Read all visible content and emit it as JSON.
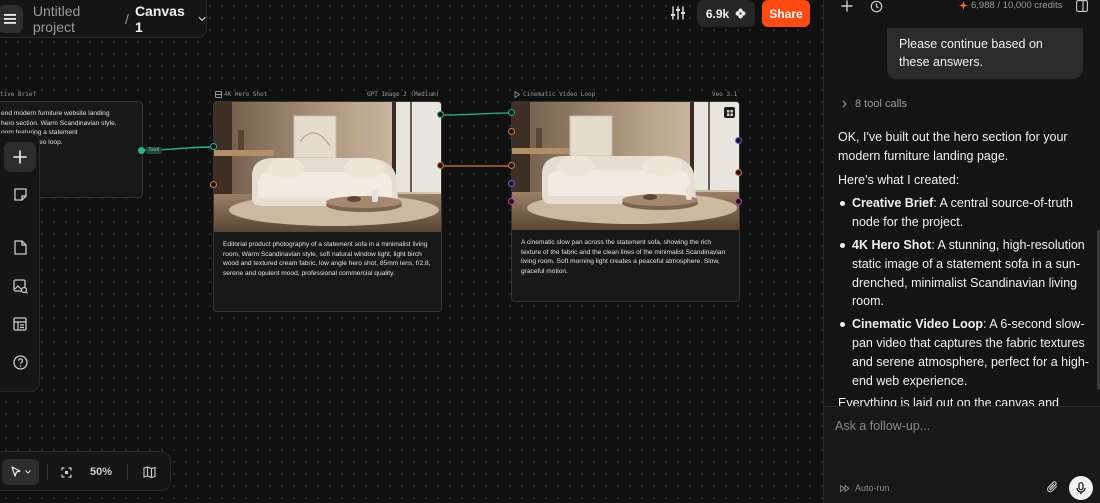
{
  "header": {
    "project_name": "Untitled project",
    "separator": "/",
    "canvas_name": "Canvas 1",
    "credits_short": "6.9k",
    "share_label": "Share"
  },
  "canvas": {
    "zoom": "50%",
    "edge_label": "Text",
    "nodes": [
      {
        "title": "tive Brief",
        "model": "",
        "text": "end modern furniture website landing\nhero section. Warm Scandinavian style,\noom featuring a statement\ncinematic video loop."
      },
      {
        "title": "4K Hero Shot",
        "model": "GPT Image 2 (Medium)",
        "text": "Editorial product photography of a statement sofa in a minimalist living room, Warm Scandinavian style, soft natural window light, light birch wood and textured cream fabric, low angle hero shot, 85mm lens, f/2.8, serene and opulent mood, professional commercial quality."
      },
      {
        "title": "Cinematic Video Loop",
        "model": "Veo 3.1",
        "text": "A cinematic slow pan across the statement sofa, showing the rich texture of the fabric and the clean lines of the minimalist Scandinavian living room. Soft morning light creates a peaceful atmosphere. Slow, graceful motion."
      }
    ]
  },
  "panel": {
    "credits": "6,988 / 10,000 credits",
    "user_message": "Please continue based on these answers.",
    "tool_calls": "8 tool calls",
    "intro": "OK, I've built out the hero section for your modern furniture landing page.",
    "created_heading": "Here's what I created:",
    "bullets": [
      {
        "name": "Creative Brief",
        "desc": ": A central source-of-truth node for the project."
      },
      {
        "name": "4K Hero Shot",
        "desc": ": A stunning, high-resolution static image of a statement sofa in a sun-drenched, minimalist Scandinavian living room."
      },
      {
        "name": "Cinematic Video Loop",
        "desc": ": A 6-second slow-pan video that captures the fabric textures and serene atmosphere, perfect for a high-end web experience."
      }
    ],
    "outro": "Everything is laid out on the canvas and",
    "composer_placeholder": "Ask a follow-up...",
    "autorun_label": "Auto-run"
  },
  "colors": {
    "accent_orange": "#ff4b12",
    "connector_teal": "#2bb58a",
    "connector_orange": "#d9773a",
    "connector_purple": "#7b5cd6",
    "connector_pink": "#d13aa0"
  }
}
